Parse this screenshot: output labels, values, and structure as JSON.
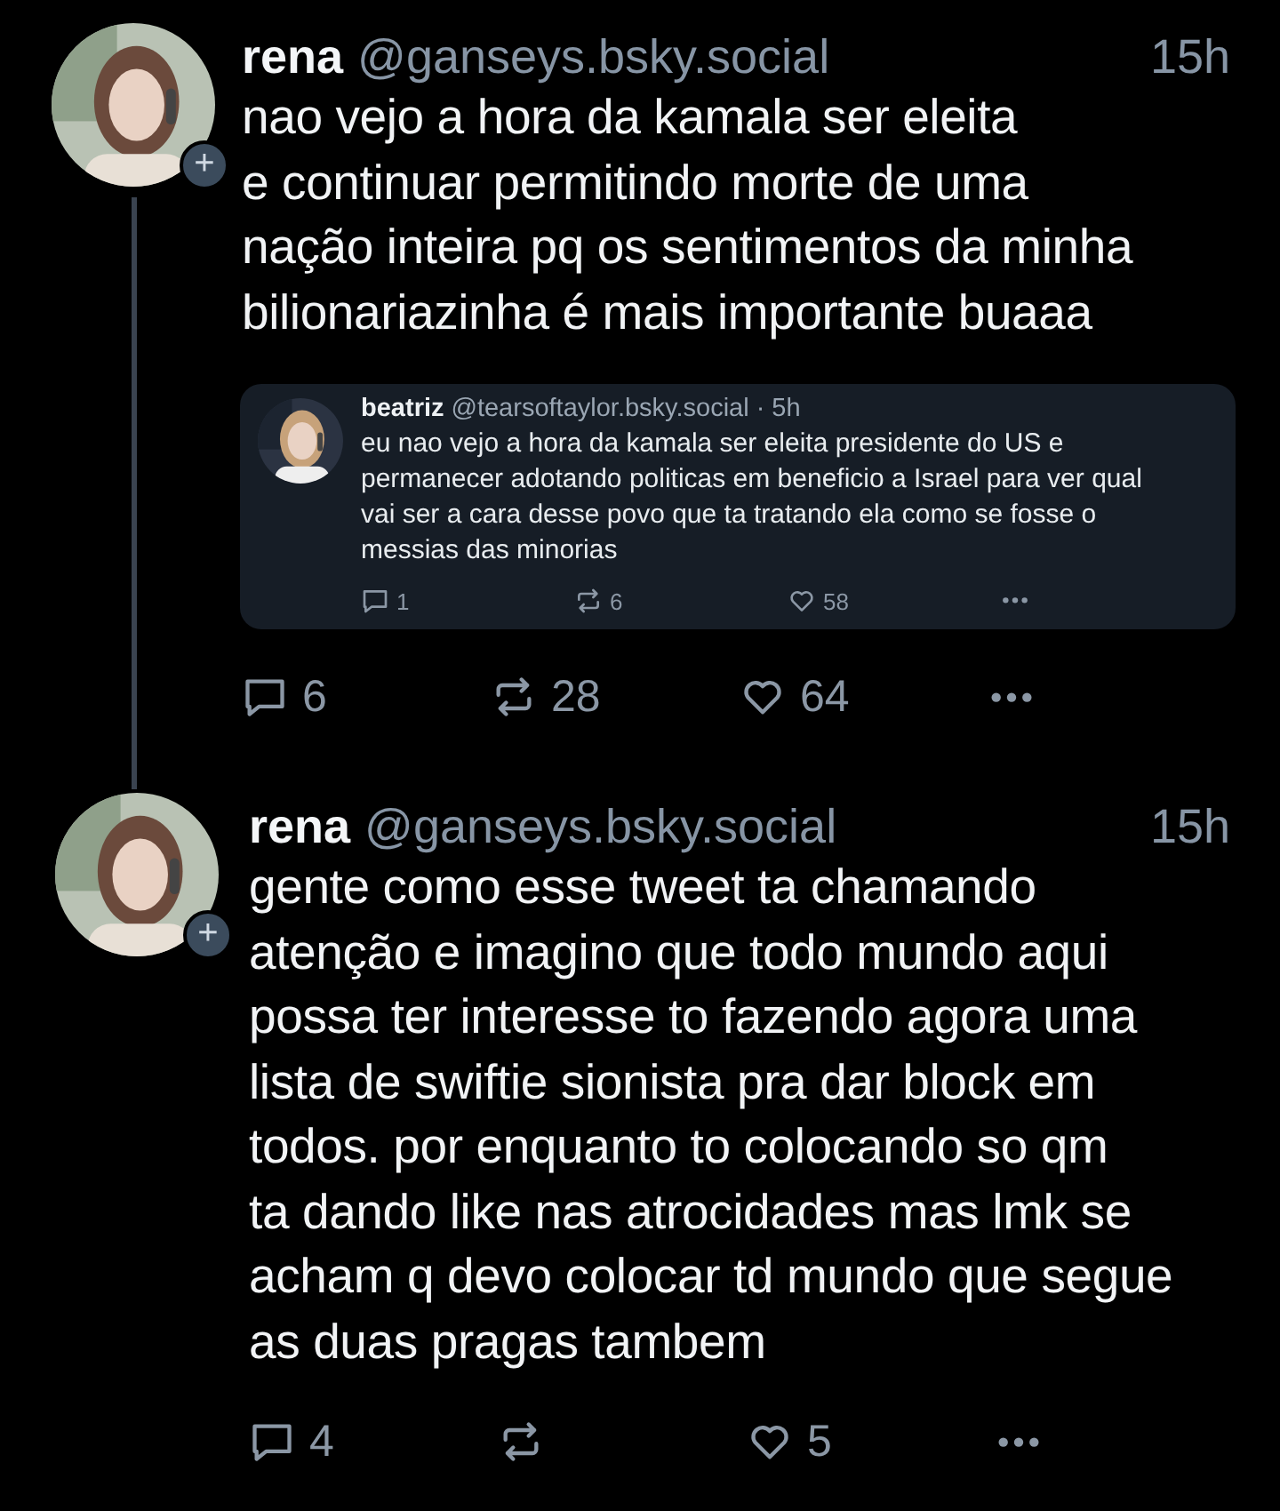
{
  "posts": [
    {
      "author": {
        "name": "rena",
        "handle": "@ganseys.bsky.social",
        "follow_badge": "+"
      },
      "time": "15h",
      "text": "nao vejo a hora da kamala ser eleita\ne continuar permitindo morte de uma\nnação inteira pq os sentimentos da minha\nbilionariazinha é mais importante buaaa",
      "thread_continues": true,
      "quote": {
        "author": {
          "name": "beatriz",
          "handle": "@tearsoftaylor.bsky.social"
        },
        "time": "· 5h",
        "text": "eu nao vejo a hora da kamala ser eleita presidente do US e\npermanecer adotando politicas em beneficio a Israel para ver qual\nvai ser a cara desse povo que ta tratando ela como se fosse o\nmessias das minorias",
        "actions": [
          {
            "kind": "reply",
            "count": "1"
          },
          {
            "kind": "repost",
            "count": "6"
          },
          {
            "kind": "like",
            "count": "58"
          },
          {
            "kind": "more"
          }
        ]
      },
      "actions": [
        {
          "kind": "reply",
          "count": "6"
        },
        {
          "kind": "repost",
          "count": "28"
        },
        {
          "kind": "like",
          "count": "64"
        },
        {
          "kind": "more"
        }
      ]
    },
    {
      "author": {
        "name": "rena",
        "handle": "@ganseys.bsky.social",
        "follow_badge": "+"
      },
      "time": "15h",
      "text": "gente como esse tweet ta chamando\natenção e imagino que todo mundo aqui\npossa ter interesse to fazendo agora uma\nlista de swiftie sionista pra dar block em\ntodos. por enquanto to colocando so qm\nta dando like nas atrocidades mas lmk se\nacham q devo colocar td mundo que segue\nas duas pragas tambem",
      "thread_continues": false,
      "actions": [
        {
          "kind": "reply",
          "count": "4"
        },
        {
          "kind": "repost"
        },
        {
          "kind": "like",
          "count": "5"
        },
        {
          "kind": "more"
        }
      ]
    }
  ]
}
